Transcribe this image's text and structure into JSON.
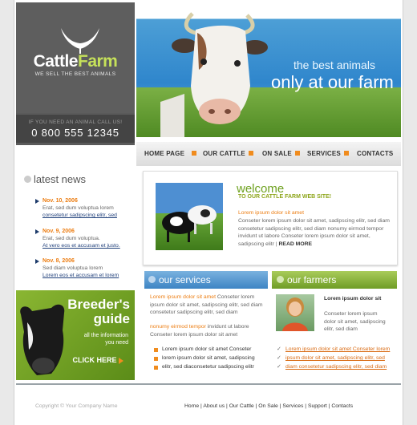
{
  "header": {
    "logo_word1": "Cattle",
    "logo_word2": "Farm",
    "tagline": "WE SELL THE BEST ANIMALS",
    "phone_label": "IF YOU NEED AN ANIMAL CALL US!",
    "phone_number": "0 800 555 12345",
    "hero_line1": "the best animals",
    "hero_line2": "only at our farm"
  },
  "nav": [
    "HOME PAGE",
    "OUR CATTLE",
    "ON SALE",
    "SERVICES",
    "CONTACTS"
  ],
  "news": {
    "title": "latest news",
    "items": [
      {
        "date": "Nov. 10, 2006",
        "text": "Erat, sed dum voluptua lorem",
        "link": "consetetur sadipscing elitr, sed"
      },
      {
        "date": "Nov. 9, 2006",
        "text": "Erat, sed dum voluptua.",
        "link": "At vero eos et accusam et justo."
      },
      {
        "date": "Nov. 8, 2006",
        "text": "Sed diam voluptua lorem",
        "link": "Lorem eos et accusam et lorem"
      }
    ]
  },
  "breeder": {
    "line1": "Breeder's",
    "line2": "guide",
    "sub1": "all the information",
    "sub2": "you need",
    "button": "CLICK HERE"
  },
  "welcome": {
    "title": "welcome",
    "subtitle": "TO OUR CATTLE FARM WEB SITE!",
    "heading": "Lorem ipsum dolor sit amet",
    "body": "Conseter lorem ipsum dolor sit amet, sadipscing elitr, sed diam consetetur sadipscing elitr, sed diam nonumy eirmod tempor invidunt ut labore Conseter lorem ipsum dolor sit amet, sadipscing elitr |",
    "read_more": "READ MORE"
  },
  "services": {
    "title": "our services",
    "p1_lead": "Lorem ipsum dolor sit amet",
    "p1_rest": " Conseter lorem ipsum dolor sit amet, sadipscing elitr, sed diam consetetur sadipscing elitr, sed diam",
    "p2_lead": "nonumy eirmod tempor",
    "p2_rest": " invidunt ut labore Conseter lorem ipsum dolor sit amet",
    "list": [
      "Lorem ipsum dolor sit amet Conseter",
      "lorem ipsum dolor sit amet, sadipscing",
      "elitr, sed diaconsetetur sadipscing elitr"
    ]
  },
  "farmers": {
    "title": "our farmers",
    "heading": "Lorem ipsum dolor sit",
    "body": "Conseter lorem ipsum dolor sit amet, sadipscing elitr, sed diam",
    "links": [
      "Lorem ipsum dolor sit amet Conseter lorem",
      "ipsum dolor sit amet, sadipscing elitr, sed",
      "diam consetetur sadipscing elitr, sed diam"
    ]
  },
  "footer": {
    "copyright": "Copyright © Your Company Name",
    "links": [
      "Home",
      "About us",
      "Our Cattle",
      "On Sale",
      "Services",
      "Support",
      "Contacts"
    ]
  },
  "colors": {
    "accent_orange": "#ec7d12",
    "accent_green": "#6ea11f",
    "accent_blue": "#3d84c4"
  }
}
